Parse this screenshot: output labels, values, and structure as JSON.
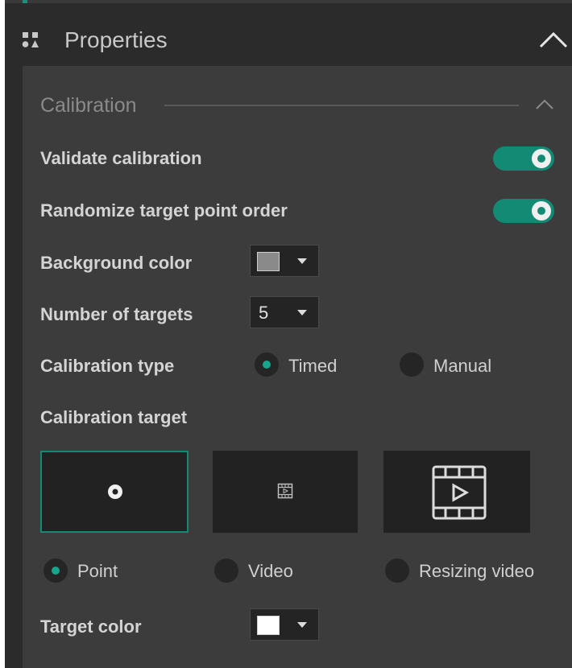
{
  "panel": {
    "title": "Properties",
    "title_icon": "properties-icon",
    "collapse_icon": "chevron-up-icon"
  },
  "section": {
    "title": "Calibration",
    "collapse_icon": "chevron-up-icon"
  },
  "settings": {
    "validate_label": "Validate calibration",
    "validate_on": true,
    "randomize_label": "Randomize target point order",
    "randomize_on": true,
    "background_label": "Background color",
    "background_color": "#8a8a8a",
    "targets_label": "Number of targets",
    "targets_value": "5",
    "type_label": "Calibration type",
    "type_options": [
      "Timed",
      "Manual"
    ],
    "type_selected": "Timed",
    "target_label": "Calibration target",
    "target_options": [
      "Point",
      "Video",
      "Resizing video"
    ],
    "target_selected": "Point",
    "target_color_label": "Target color",
    "target_color": "#ffffff"
  },
  "colors": {
    "accent": "#138a74",
    "panel_bg": "#2b2b2b",
    "content_bg": "#3c3c3c"
  }
}
